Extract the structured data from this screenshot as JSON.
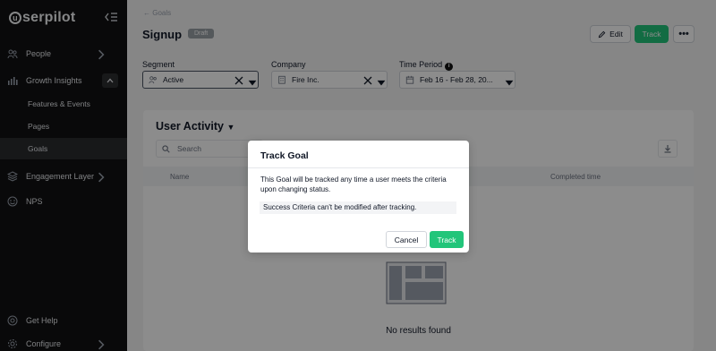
{
  "app": {
    "logo_text": "serpilot",
    "logo_mark": "u"
  },
  "sidebar": {
    "items": [
      {
        "label": "People",
        "icon": "people-icon"
      },
      {
        "label": "Growth Insights",
        "icon": "bar-chart-icon"
      },
      {
        "label": "Engagement Layer",
        "icon": "layers-icon"
      },
      {
        "label": "NPS",
        "icon": "nps-icon"
      }
    ],
    "sub_items": [
      {
        "label": "Features & Events"
      },
      {
        "label": "Pages"
      },
      {
        "label": "Goals",
        "active": true
      }
    ],
    "footer": [
      {
        "label": "Get Help",
        "icon": "lifebuoy-icon"
      },
      {
        "label": "Configure",
        "icon": "gear-icon"
      }
    ]
  },
  "header": {
    "breadcrumb": "Goals",
    "title": "Signup",
    "badge": "Draft",
    "edit_label": "Edit",
    "track_label": "Track",
    "more_label": "•••"
  },
  "filters": {
    "segment_label": "Segment",
    "segment_value": "Active",
    "company_label": "Company",
    "company_value": "Fire Inc.",
    "period_label": "Time Period",
    "period_value": "Feb 16 - Feb 28, 20..."
  },
  "card": {
    "title": "User Activity",
    "search_placeholder": "Search",
    "columns": [
      "Name",
      "Completed time"
    ],
    "empty_text": "No results found"
  },
  "modal": {
    "title": "Track Goal",
    "body": "This Goal will be tracked any time a user meets the criteria upon changing status.",
    "note": "Success Criteria can't be modified after tracking.",
    "cancel_label": "Cancel",
    "track_label": "Track"
  },
  "colors": {
    "accent": "#22c57a",
    "sidebar_bg": "#111213"
  }
}
